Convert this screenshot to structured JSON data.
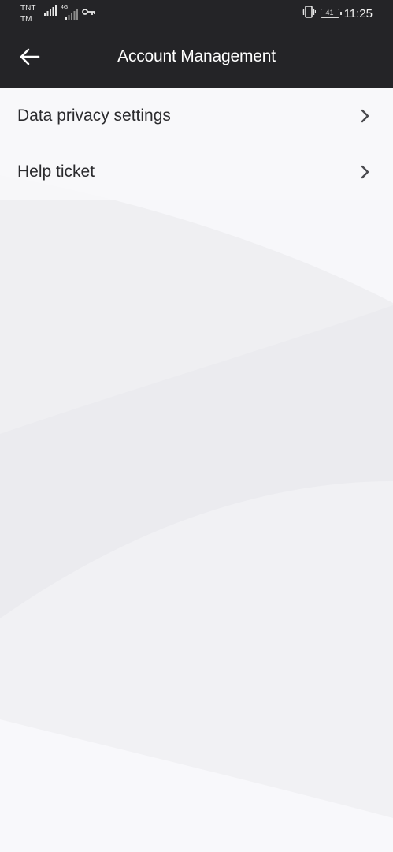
{
  "status_bar": {
    "carrier_line1": "TNT",
    "carrier_line2": "TM",
    "network_type": "4G",
    "battery_level": "41",
    "time": "11:25",
    "icons": [
      "signal-icon",
      "signal-4g-icon",
      "vpn-key-icon",
      "vibrate-icon",
      "battery-icon"
    ]
  },
  "app_bar": {
    "back_icon": "arrow-left-icon",
    "title": "Account Management"
  },
  "menu": {
    "items": [
      {
        "label": "Data privacy settings",
        "icon": "chevron-right-icon"
      },
      {
        "label": "Help ticket",
        "icon": "chevron-right-icon"
      }
    ]
  },
  "colors": {
    "header_bg": "#242427",
    "header_text": "#ffffff",
    "page_bg": "#f7f7fa",
    "item_text": "#2b2b2e",
    "divider": "#9a9a9e"
  }
}
